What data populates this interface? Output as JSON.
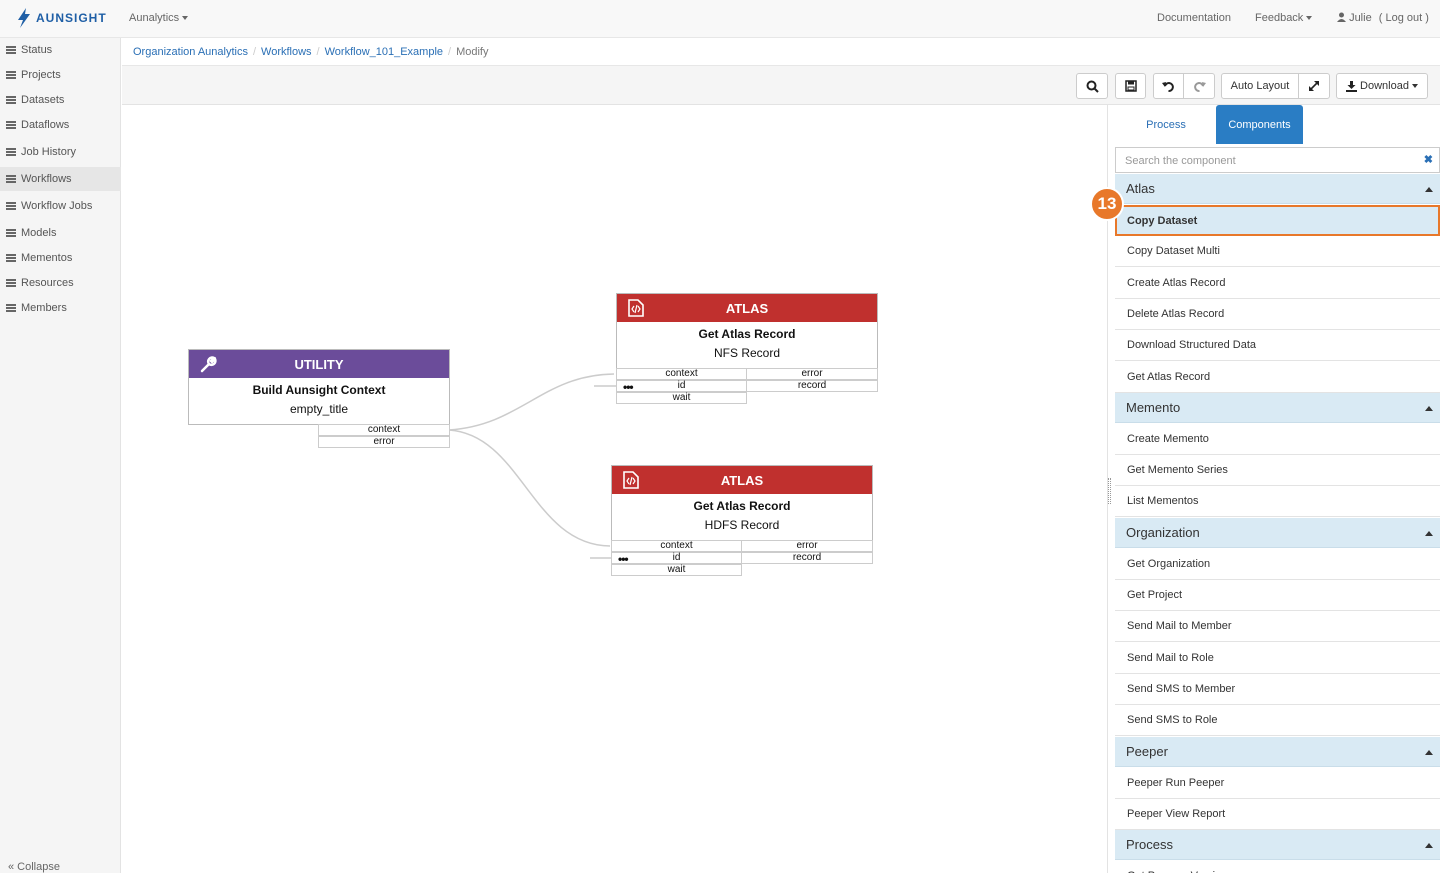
{
  "nav": {
    "logo_text": "AUNSIGHT",
    "org_menu": "Aunalytics",
    "documentation": "Documentation",
    "feedback": "Feedback",
    "user": "Julie",
    "logout": "( Log out )"
  },
  "sidebar": {
    "items": [
      {
        "label": "Status",
        "icon": "dashboard-icon"
      },
      {
        "label": "Projects",
        "icon": "list-icon"
      },
      {
        "label": "Datasets",
        "icon": "file-icon"
      },
      {
        "label": "Dataflows",
        "icon": "sitemap-icon"
      },
      {
        "label": "Job History",
        "icon": "cogs-icon"
      },
      {
        "label": "Workflows",
        "icon": "workflow-icon"
      },
      {
        "label": "Workflow Jobs",
        "icon": "workflow-jobs-icon"
      },
      {
        "label": "Models",
        "icon": "model-icon"
      },
      {
        "label": "Mementos",
        "icon": "bookmark-icon"
      },
      {
        "label": "Resources",
        "icon": "resources-icon"
      },
      {
        "label": "Members",
        "icon": "users-icon"
      }
    ],
    "collapse": "« Collapse"
  },
  "breadcrumb": {
    "items": [
      "Organization Aunalytics",
      "Workflows",
      "Workflow_101_Example"
    ],
    "current": "Modify"
  },
  "toolbar": {
    "auto_layout": "Auto Layout",
    "download": "Download"
  },
  "canvas": {
    "nodes": [
      {
        "type": "UTILITY",
        "title": "Build Aunsight Context",
        "subtitle": "empty_title",
        "color": "#6b4c9a",
        "outputs": [
          "context",
          "error"
        ]
      },
      {
        "type": "ATLAS",
        "title": "Get Atlas Record",
        "subtitle": "NFS Record",
        "color": "#c0302e",
        "inputs": [
          "context",
          "id",
          "wait"
        ],
        "outputs": [
          "error",
          "record"
        ]
      },
      {
        "type": "ATLAS",
        "title": "Get Atlas Record",
        "subtitle": "HDFS Record",
        "color": "#c0302e",
        "inputs": [
          "context",
          "id",
          "wait"
        ],
        "outputs": [
          "error",
          "record"
        ]
      }
    ],
    "dots": "•••"
  },
  "panel": {
    "tabs": {
      "process": "Process",
      "components": "Components"
    },
    "search_placeholder": "Search the component",
    "search_clear": "✖",
    "badge": "13",
    "categories": [
      {
        "name": "Atlas",
        "items": [
          "Copy Dataset",
          "Copy Dataset Multi",
          "Create Atlas Record",
          "Delete Atlas Record",
          "Download Structured Data",
          "Get Atlas Record"
        ]
      },
      {
        "name": "Memento",
        "items": [
          "Create Memento",
          "Get Memento Series",
          "List Mementos"
        ]
      },
      {
        "name": "Organization",
        "items": [
          "Get Organization",
          "Get Project",
          "Send Mail to Member",
          "Send Mail to Role",
          "Send SMS to Member",
          "Send SMS to Role"
        ]
      },
      {
        "name": "Peeper",
        "items": [
          "Peeper Run Peeper",
          "Peeper View Report"
        ]
      },
      {
        "name": "Process",
        "items": [
          "Get Process Version"
        ]
      }
    ]
  },
  "colors": {
    "accent": "#2a6fb5",
    "highlight": "#e8782a",
    "utility": "#6b4c9a",
    "atlas": "#c0302e",
    "category_bg": "#d9eaf4"
  }
}
